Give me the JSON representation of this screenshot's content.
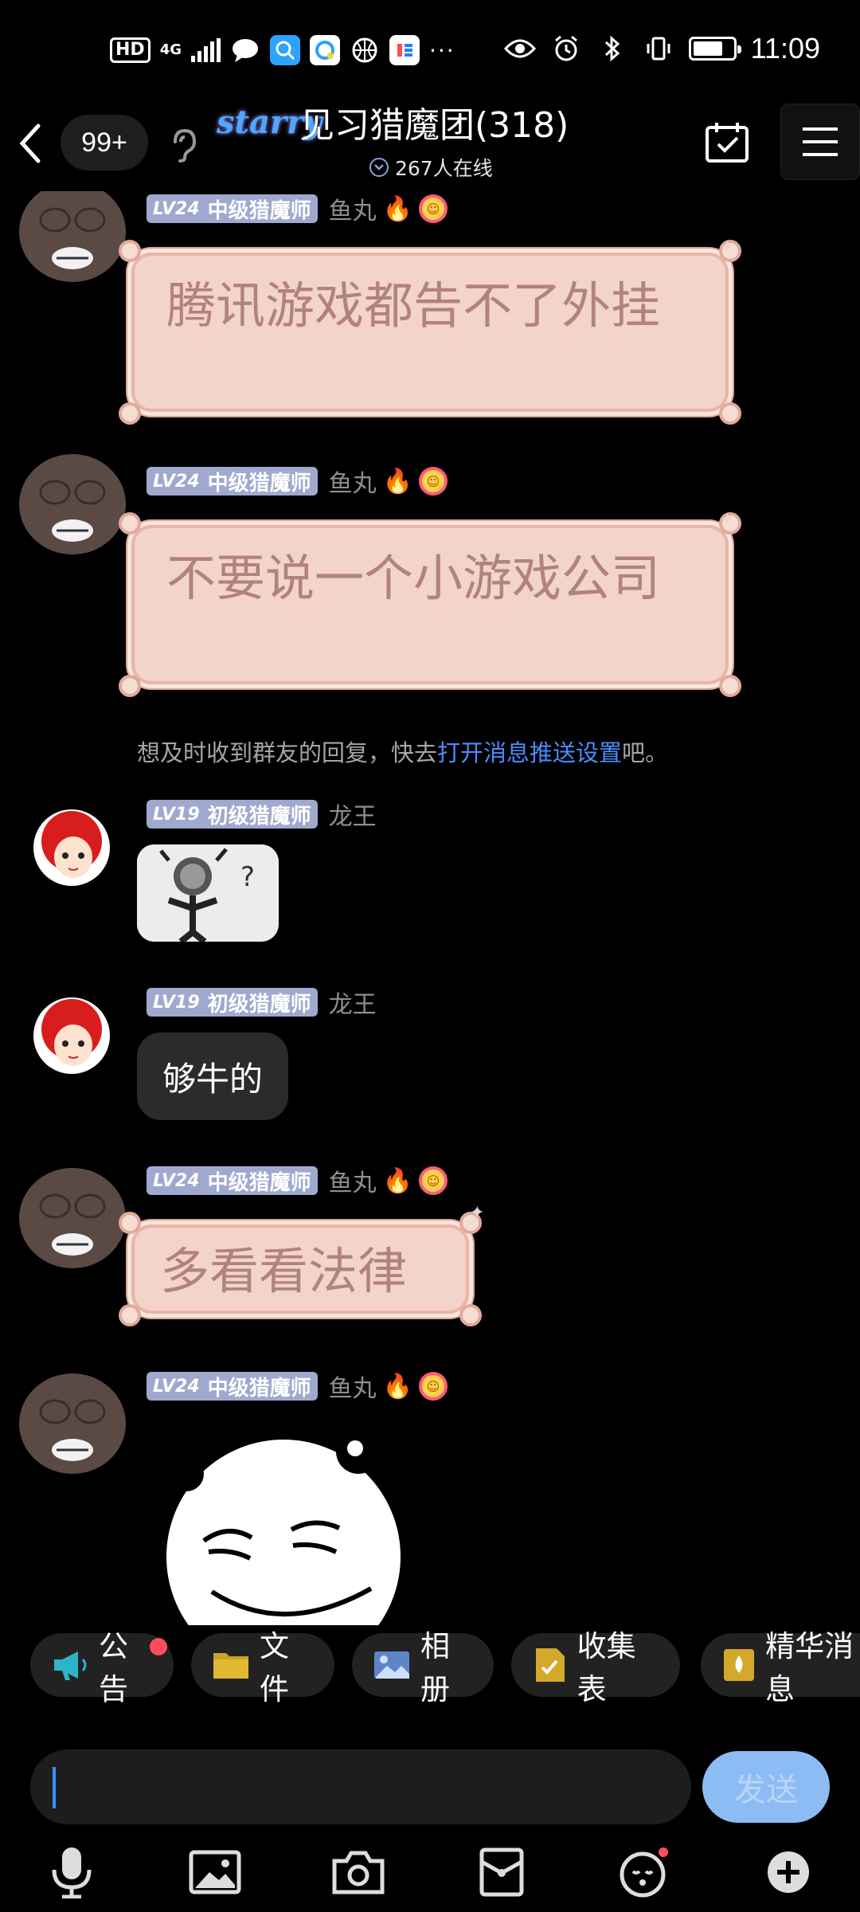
{
  "status_bar": {
    "hd": "HD",
    "network": "4G",
    "time": "11:09",
    "battery_percent": 75,
    "app_icons": [
      "message-icon",
      "qq-icon",
      "qq-browser-icon",
      "basketball-icon",
      "app-icon"
    ],
    "more": "···"
  },
  "header": {
    "unread_count": "99+",
    "logo_text": "starry",
    "title": "见习猎魔团(318)",
    "online_text": "267人在线"
  },
  "messages": [
    {
      "level": "LV24",
      "rank": "中级猎魔师",
      "nick": "鱼丸",
      "text": "腾讯游戏都告不了外挂"
    },
    {
      "level": "LV24",
      "rank": "中级猎魔师",
      "nick": "鱼丸",
      "text": "不要说一个小游戏公司"
    },
    {
      "level": "LV19",
      "rank": "初级猎魔师",
      "nick": "龙王",
      "image": "question-stickman-image"
    },
    {
      "level": "LV19",
      "rank": "初级猎魔师",
      "nick": "龙王",
      "text": "够牛的"
    },
    {
      "level": "LV24",
      "rank": "中级猎魔师",
      "nick": "鱼丸",
      "text": "多看看法律"
    },
    {
      "level": "LV24",
      "rank": "中级猎魔师",
      "nick": "鱼丸",
      "image": "smiling-panda-sticker"
    }
  ],
  "system_tip": {
    "prefix": "想及时收到群友的回复，快去",
    "link": "打开消息推送设置",
    "suffix": "吧。"
  },
  "shortcuts": [
    {
      "label": "公告",
      "icon": "megaphone-icon"
    },
    {
      "label": "文件",
      "icon": "folder-icon"
    },
    {
      "label": "相册",
      "icon": "photo-album-icon"
    },
    {
      "label": "收集表",
      "icon": "form-icon"
    },
    {
      "label": "精华消息",
      "icon": "essence-icon"
    }
  ],
  "input": {
    "send_label": "发送"
  },
  "colors": {
    "bubble_scroll": "#f3d4ca",
    "bubble_text": "#b2837a",
    "level_badge": "#9fa9cf",
    "link": "#4a8cff",
    "send_button": "#8dbcf4"
  }
}
